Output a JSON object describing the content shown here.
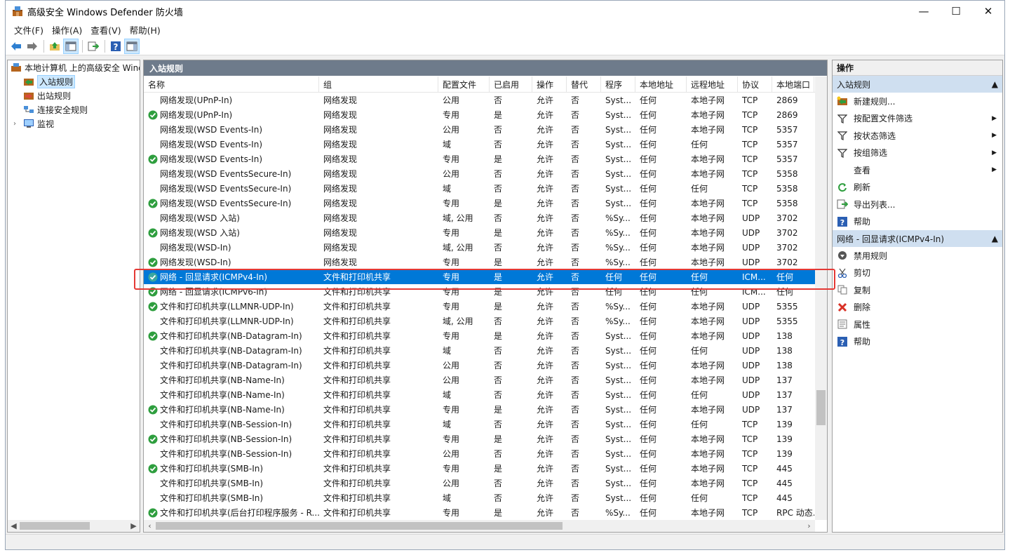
{
  "window": {
    "title": "高级安全 Windows Defender 防火墙"
  },
  "menu": [
    "文件(F)",
    "操作(A)",
    "查看(V)",
    "帮助(H)"
  ],
  "tree": {
    "root": "本地计算机 上的高级安全 Windows Defender 防火墙",
    "items": [
      {
        "label": "入站规则",
        "selected": true
      },
      {
        "label": "出站规则"
      },
      {
        "label": "连接安全规则"
      },
      {
        "label": "监视",
        "expandable": true
      }
    ]
  },
  "center": {
    "title": "入站规则",
    "columns": [
      "名称",
      "组",
      "配置文件",
      "已启用",
      "操作",
      "替代",
      "程序",
      "本地地址",
      "远程地址",
      "协议",
      "本地端口"
    ],
    "rows": [
      {
        "enabled": false,
        "cells": [
          "网络发现(UPnP-In)",
          "网络发现",
          "公用",
          "否",
          "允许",
          "否",
          "Syst...",
          "任何",
          "本地子网",
          "TCP",
          "2869"
        ]
      },
      {
        "enabled": true,
        "cells": [
          "网络发现(UPnP-In)",
          "网络发现",
          "专用",
          "是",
          "允许",
          "否",
          "Syst...",
          "任何",
          "本地子网",
          "TCP",
          "2869"
        ]
      },
      {
        "enabled": false,
        "cells": [
          "网络发现(WSD Events-In)",
          "网络发现",
          "公用",
          "否",
          "允许",
          "否",
          "Syst...",
          "任何",
          "本地子网",
          "TCP",
          "5357"
        ]
      },
      {
        "enabled": false,
        "cells": [
          "网络发现(WSD Events-In)",
          "网络发现",
          "域",
          "否",
          "允许",
          "否",
          "Syst...",
          "任何",
          "任何",
          "TCP",
          "5357"
        ]
      },
      {
        "enabled": true,
        "cells": [
          "网络发现(WSD Events-In)",
          "网络发现",
          "专用",
          "是",
          "允许",
          "否",
          "Syst...",
          "任何",
          "本地子网",
          "TCP",
          "5357"
        ]
      },
      {
        "enabled": false,
        "cells": [
          "网络发现(WSD EventsSecure-In)",
          "网络发现",
          "公用",
          "否",
          "允许",
          "否",
          "Syst...",
          "任何",
          "本地子网",
          "TCP",
          "5358"
        ]
      },
      {
        "enabled": false,
        "cells": [
          "网络发现(WSD EventsSecure-In)",
          "网络发现",
          "域",
          "否",
          "允许",
          "否",
          "Syst...",
          "任何",
          "任何",
          "TCP",
          "5358"
        ]
      },
      {
        "enabled": true,
        "cells": [
          "网络发现(WSD EventsSecure-In)",
          "网络发现",
          "专用",
          "是",
          "允许",
          "否",
          "Syst...",
          "任何",
          "本地子网",
          "TCP",
          "5358"
        ]
      },
      {
        "enabled": false,
        "cells": [
          "网络发现(WSD 入站)",
          "网络发现",
          "域, 公用",
          "否",
          "允许",
          "否",
          "%Sy...",
          "任何",
          "本地子网",
          "UDP",
          "3702"
        ]
      },
      {
        "enabled": true,
        "cells": [
          "网络发现(WSD 入站)",
          "网络发现",
          "专用",
          "是",
          "允许",
          "否",
          "%Sy...",
          "任何",
          "本地子网",
          "UDP",
          "3702"
        ]
      },
      {
        "enabled": false,
        "cells": [
          "网络发现(WSD-In)",
          "网络发现",
          "域, 公用",
          "否",
          "允许",
          "否",
          "%Sy...",
          "任何",
          "本地子网",
          "UDP",
          "3702"
        ]
      },
      {
        "enabled": true,
        "cells": [
          "网络发现(WSD-In)",
          "网络发现",
          "专用",
          "是",
          "允许",
          "否",
          "%Sy...",
          "任何",
          "本地子网",
          "UDP",
          "3702"
        ]
      },
      {
        "enabled": true,
        "selected": true,
        "cells": [
          "网络 - 回显请求(ICMPv4-In)",
          "文件和打印机共享",
          "专用",
          "是",
          "允许",
          "否",
          "任何",
          "任何",
          "任何",
          "ICM...",
          "任何"
        ]
      },
      {
        "enabled": true,
        "cells": [
          "网络 - 回显请求(ICMPv6-In)",
          "文件和打印机共享",
          "专用",
          "是",
          "允许",
          "否",
          "任何",
          "任何",
          "任何",
          "ICM...",
          "任何"
        ]
      },
      {
        "enabled": true,
        "cells": [
          "文件和打印机共享(LLMNR-UDP-In)",
          "文件和打印机共享",
          "专用",
          "是",
          "允许",
          "否",
          "%Sy...",
          "任何",
          "本地子网",
          "UDP",
          "5355"
        ]
      },
      {
        "enabled": false,
        "cells": [
          "文件和打印机共享(LLMNR-UDP-In)",
          "文件和打印机共享",
          "域, 公用",
          "否",
          "允许",
          "否",
          "%Sy...",
          "任何",
          "本地子网",
          "UDP",
          "5355"
        ]
      },
      {
        "enabled": true,
        "cells": [
          "文件和打印机共享(NB-Datagram-In)",
          "文件和打印机共享",
          "专用",
          "是",
          "允许",
          "否",
          "Syst...",
          "任何",
          "本地子网",
          "UDP",
          "138"
        ]
      },
      {
        "enabled": false,
        "cells": [
          "文件和打印机共享(NB-Datagram-In)",
          "文件和打印机共享",
          "域",
          "否",
          "允许",
          "否",
          "Syst...",
          "任何",
          "任何",
          "UDP",
          "138"
        ]
      },
      {
        "enabled": false,
        "cells": [
          "文件和打印机共享(NB-Datagram-In)",
          "文件和打印机共享",
          "公用",
          "否",
          "允许",
          "否",
          "Syst...",
          "任何",
          "本地子网",
          "UDP",
          "138"
        ]
      },
      {
        "enabled": false,
        "cells": [
          "文件和打印机共享(NB-Name-In)",
          "文件和打印机共享",
          "公用",
          "否",
          "允许",
          "否",
          "Syst...",
          "任何",
          "本地子网",
          "UDP",
          "137"
        ]
      },
      {
        "enabled": false,
        "cells": [
          "文件和打印机共享(NB-Name-In)",
          "文件和打印机共享",
          "域",
          "否",
          "允许",
          "否",
          "Syst...",
          "任何",
          "任何",
          "UDP",
          "137"
        ]
      },
      {
        "enabled": true,
        "cells": [
          "文件和打印机共享(NB-Name-In)",
          "文件和打印机共享",
          "专用",
          "是",
          "允许",
          "否",
          "Syst...",
          "任何",
          "本地子网",
          "UDP",
          "137"
        ]
      },
      {
        "enabled": false,
        "cells": [
          "文件和打印机共享(NB-Session-In)",
          "文件和打印机共享",
          "域",
          "否",
          "允许",
          "否",
          "Syst...",
          "任何",
          "任何",
          "TCP",
          "139"
        ]
      },
      {
        "enabled": true,
        "cells": [
          "文件和打印机共享(NB-Session-In)",
          "文件和打印机共享",
          "专用",
          "是",
          "允许",
          "否",
          "Syst...",
          "任何",
          "本地子网",
          "TCP",
          "139"
        ]
      },
      {
        "enabled": false,
        "cells": [
          "文件和打印机共享(NB-Session-In)",
          "文件和打印机共享",
          "公用",
          "否",
          "允许",
          "否",
          "Syst...",
          "任何",
          "本地子网",
          "TCP",
          "139"
        ]
      },
      {
        "enabled": true,
        "cells": [
          "文件和打印机共享(SMB-In)",
          "文件和打印机共享",
          "专用",
          "是",
          "允许",
          "否",
          "Syst...",
          "任何",
          "本地子网",
          "TCP",
          "445"
        ]
      },
      {
        "enabled": false,
        "cells": [
          "文件和打印机共享(SMB-In)",
          "文件和打印机共享",
          "公用",
          "否",
          "允许",
          "否",
          "Syst...",
          "任何",
          "本地子网",
          "TCP",
          "445"
        ]
      },
      {
        "enabled": false,
        "cells": [
          "文件和打印机共享(SMB-In)",
          "文件和打印机共享",
          "域",
          "否",
          "允许",
          "否",
          "Syst...",
          "任何",
          "任何",
          "TCP",
          "445"
        ]
      },
      {
        "enabled": true,
        "cells": [
          "文件和打印机共享(后台打印程序服务 - R...",
          "文件和打印机共享",
          "专用",
          "是",
          "允许",
          "否",
          "%Sy...",
          "任何",
          "本地子网",
          "TCP",
          "RPC 动态..."
        ]
      }
    ]
  },
  "actions": {
    "title": "操作",
    "section1": "入站规则",
    "items1": [
      {
        "label": "新建规则...",
        "icon": "new-rule-icon"
      },
      {
        "label": "按配置文件筛选",
        "icon": "filter-icon",
        "submenu": true
      },
      {
        "label": "按状态筛选",
        "icon": "filter-icon",
        "submenu": true
      },
      {
        "label": "按组筛选",
        "icon": "filter-icon",
        "submenu": true
      },
      {
        "label": "查看",
        "icon": "",
        "submenu": true
      },
      {
        "label": "刷新",
        "icon": "refresh-icon"
      },
      {
        "label": "导出列表...",
        "icon": "export-icon"
      },
      {
        "label": "帮助",
        "icon": "help-icon"
      }
    ],
    "section2": "网络 - 回显请求(ICMPv4-In)",
    "items2": [
      {
        "label": "禁用规则",
        "icon": "disable-icon"
      },
      {
        "label": "剪切",
        "icon": "cut-icon"
      },
      {
        "label": "复制",
        "icon": "copy-icon"
      },
      {
        "label": "删除",
        "icon": "delete-icon"
      },
      {
        "label": "属性",
        "icon": "properties-icon"
      },
      {
        "label": "帮助",
        "icon": "help-icon"
      }
    ]
  },
  "colors": {
    "selected_row": "#0078d7",
    "header_bar": "#6e7b8b",
    "section_head": "#cfdff0",
    "enabled_check": "#2e9e3e",
    "highlight_border": "#e53935"
  }
}
